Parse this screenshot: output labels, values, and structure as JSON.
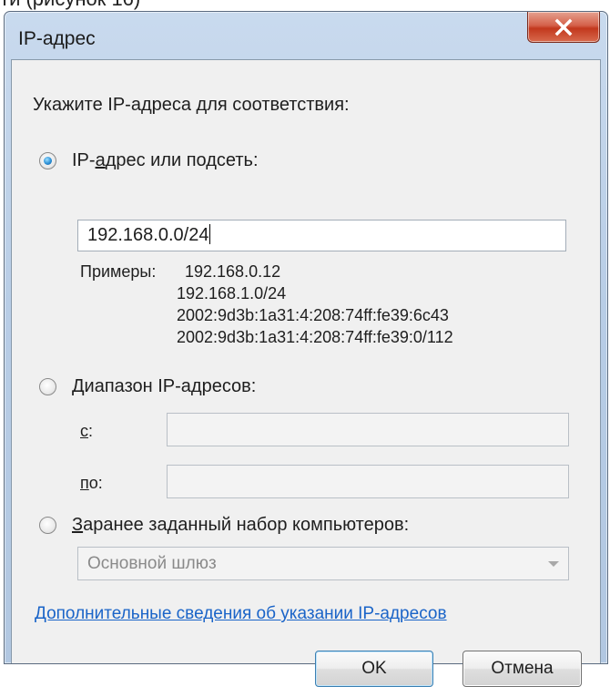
{
  "page": {
    "cropped_text": "ти (рисунок 16)"
  },
  "window": {
    "title": "IP-адрес"
  },
  "dialog": {
    "instruction": "Укажите IP-адреса для соответствия:",
    "option_subnet": {
      "label_before": "IP-",
      "label_underlined": "а",
      "label_after": "дрес или подсеть:",
      "selected": true
    },
    "subnet_value": "192.168.0.0/24",
    "examples_label": "Примеры:",
    "examples": [
      "192.168.0.12",
      "192.168.1.0/24",
      "2002:9d3b:1a31:4:208:74ff:fe39:6c43",
      "2002:9d3b:1a31:4:208:74ff:fe39:0/112"
    ],
    "option_range": {
      "label_underlined": "Д",
      "label_after": "иапазон IP-адресов:",
      "selected": false
    },
    "range_from": {
      "label_underlined": "с",
      "label_after": ":",
      "value": ""
    },
    "range_to": {
      "label_underlined": "п",
      "label_after": "о:",
      "value": ""
    },
    "option_predefined": {
      "label_underlined": "З",
      "label_after": "аранее заданный набор компьютеров:",
      "selected": false
    },
    "predefined_selected": "Основной шлюз",
    "link": "Дополнительные сведения об указании IP-адресов",
    "ok_label": "OK",
    "cancel_label": "Отмена"
  },
  "colors": {
    "link": "#1a64c8",
    "close_button": "#c2381d",
    "window_frame": "#b8cde6"
  },
  "icons": {
    "close": "close-icon",
    "dropdown": "chevron-down-icon"
  }
}
